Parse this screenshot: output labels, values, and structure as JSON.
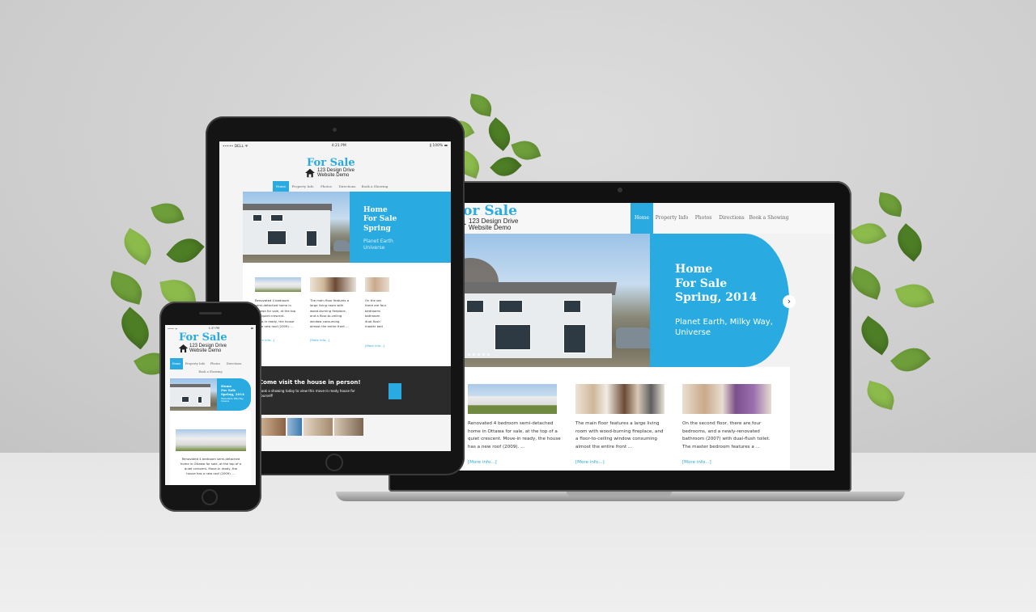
{
  "site": {
    "brand_title": "For Sale",
    "brand_line1": "123 Design Drive",
    "brand_line2": "Website Demo",
    "nav": [
      "Home",
      "Property Info",
      "Photos",
      "Directions",
      "Book a Showing"
    ],
    "hero_title_1": "Home",
    "hero_title_2": "For Sale",
    "hero_title_3": "Spring, 2014",
    "hero_sub_1": "Planet Earth, Milky Way,",
    "hero_sub_2": "Universe",
    "cards": [
      {
        "lines": [
          "Renovated 4 bedroom semi-detached",
          "home in Ottawa for sale, at the top of a",
          "quiet crescent. Move-in ready, the house",
          "has a new roof (2009). ..."
        ],
        "link": "[More info...]"
      },
      {
        "lines": [
          "The main floor features a large living",
          "room with wood-burning fireplace, and",
          "a floor-to-ceiling window consuming",
          "almost the entire front ..."
        ],
        "link": "[More info...]"
      },
      {
        "lines": [
          "On the second floor, there are four",
          "bedrooms, and a newly-renovated",
          "bathroom (2007) with dual-flush toilet.",
          "The master bedroom features a ..."
        ],
        "link": "[More info...]"
      }
    ],
    "prev_arrow": "‹",
    "next_arrow": "›"
  },
  "tablet": {
    "status_left": "••••• DELL ᯤ",
    "status_time": "4:21 PM",
    "status_right": "∦ 100% ▬",
    "hero_title_1": "Home",
    "hero_title_2": "For Sale",
    "hero_title_3": "Spring",
    "hero_sub_1": "Planet Earth",
    "hero_sub_2": "Universe",
    "cards": [
      {
        "lines": [
          "Renovated 4 bedroom",
          "semi-detached home in",
          "Ottawa for sale, at the top",
          "of a quiet crescent.",
          "Move-in ready, the house",
          "has a new roof (2009). ..."
        ],
        "link": "[More info...]"
      },
      {
        "lines": [
          "The main floor features a",
          "large living room with",
          "wood-burning fireplace,",
          "and a floor-to-ceiling",
          "window consuming",
          "almost the entire front ..."
        ],
        "link": "[More info...]"
      },
      {
        "lines": [
          "On the sec",
          "there are four",
          "bedrooms",
          "bathroom",
          "dual-flush",
          "master bed"
        ],
        "link": "[More info...]"
      }
    ],
    "band_title": "Come visit the house in person!",
    "band_text_1": "Book a showing today to view this move-in ready house for",
    "band_text_2": "yourself!"
  },
  "phone": {
    "status_left": "•••• ᯤ",
    "status_time": "1:37 PM",
    "status_right": "▬",
    "nav_row1": [
      "Home",
      "Property Info",
      "Photos",
      "Directions"
    ],
    "nav_row2": "Book a Showing",
    "hero_title_1": "Home",
    "hero_title_2": "For Sale",
    "hero_title_3": "Spring, 2014",
    "hero_sub": "Planet Earth, Milky Way, Universe",
    "card_lines": [
      "Renovated 4 bedroom semi-detached",
      "home in Ottawa for sale, at the top of a",
      "quiet crescent. Move-in ready, the",
      "house has a new roof (2009). ..."
    ]
  },
  "colors": {
    "accent": "#29abe2",
    "dark_band": "#2b2b2b"
  }
}
